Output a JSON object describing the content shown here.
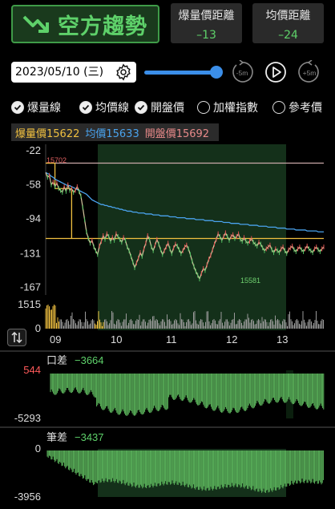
{
  "header": {
    "trend_title": "空方趨勢",
    "metric1": {
      "label": "爆量價距離",
      "value": "–13"
    },
    "metric2": {
      "label": "均價距離",
      "value": "–24"
    }
  },
  "controls": {
    "date": "2023/05/10 (三)",
    "back_label": "-5m",
    "forward_label": "+5m",
    "slider_fraction": 1.0
  },
  "toggles": [
    {
      "label": "爆量線",
      "checked": true
    },
    {
      "label": "均價線",
      "checked": true
    },
    {
      "label": "開盤價",
      "checked": true
    },
    {
      "label": "加權指數",
      "checked": false
    },
    {
      "label": "參考價",
      "checked": false
    }
  ],
  "legend": {
    "burst": {
      "label": "爆量價15622",
      "color": "#f0c040"
    },
    "avg": {
      "label": "均價15633",
      "color": "#4aa3ee"
    },
    "open": {
      "label": "開盤價15692",
      "color": "#e88a8a"
    }
  },
  "chart_data": [
    {
      "type": "line",
      "name": "price",
      "yticks": [
        "-22",
        "-58",
        "-94",
        "-131",
        "-167"
      ],
      "ylim": [
        -175,
        -15
      ],
      "x": [
        0,
        2,
        4,
        6,
        8,
        10,
        12,
        14,
        16,
        18,
        20,
        22,
        24,
        26,
        28,
        30,
        32,
        34,
        36,
        38,
        40,
        42,
        44,
        46,
        48,
        50,
        52,
        54,
        56,
        58,
        60,
        62,
        64,
        66,
        68,
        70,
        72,
        74,
        76,
        78,
        80,
        82,
        84,
        86,
        88,
        90,
        92,
        94,
        96,
        98,
        100,
        102,
        104,
        106,
        108,
        110,
        112,
        114,
        116,
        118,
        120,
        122,
        124,
        126,
        128,
        130,
        132,
        134,
        136,
        138,
        140,
        142,
        144,
        146,
        148,
        150,
        152,
        154,
        156,
        158,
        160,
        162,
        164,
        166,
        168,
        170,
        172,
        174,
        176,
        178,
        180,
        182,
        184,
        186,
        188,
        190,
        192,
        194,
        196,
        198,
        200,
        202,
        204,
        206,
        208,
        210,
        212,
        214,
        216,
        218,
        220,
        222,
        224,
        226,
        228,
        230,
        232,
        234,
        236,
        238,
        240,
        242,
        244,
        246,
        248,
        250,
        252,
        254,
        256,
        258,
        260,
        262,
        264,
        266,
        268,
        270,
        272,
        274,
        276,
        278,
        280,
        282,
        284,
        286,
        288,
        290,
        292,
        294,
        296,
        298,
        300
      ],
      "price": [
        -45,
        -50,
        -48,
        -58,
        -55,
        -60,
        -56,
        -62,
        -64,
        -66,
        -60,
        -65,
        -58,
        -64,
        -62,
        -66,
        -64,
        -60,
        -65,
        -70,
        -82,
        -95,
        -108,
        -115,
        -120,
        -117,
        -124,
        -128,
        -132,
        -123,
        -118,
        -112,
        -116,
        -110,
        -113,
        -118,
        -114,
        -117,
        -110,
        -113,
        -116,
        -119,
        -114,
        -117,
        -124,
        -128,
        -134,
        -140,
        -146,
        -141,
        -136,
        -130,
        -134,
        -126,
        -120,
        -112,
        -116,
        -124,
        -128,
        -122,
        -116,
        -121,
        -127,
        -132,
        -128,
        -124,
        -120,
        -126,
        -131,
        -125,
        -121,
        -123,
        -127,
        -131,
        -128,
        -124,
        -122,
        -126,
        -132,
        -139,
        -145,
        -150,
        -154,
        -158,
        -152,
        -147,
        -149,
        -143,
        -137,
        -133,
        -127,
        -121,
        -116,
        -110,
        -113,
        -117,
        -113,
        -109,
        -113,
        -117,
        -113,
        -111,
        -115,
        -113,
        -110,
        -116,
        -118,
        -114,
        -118,
        -120,
        -118,
        -115,
        -119,
        -121,
        -123,
        -119,
        -121,
        -125,
        -128,
        -126,
        -124,
        -122,
        -127,
        -130,
        -126,
        -128,
        -130,
        -126,
        -124,
        -128,
        -131,
        -127,
        -125,
        -123,
        -127,
        -129,
        -126,
        -124,
        -127,
        -129,
        -126,
        -123,
        -126,
        -128,
        -130,
        -126,
        -124,
        -127,
        -129,
        -126,
        -124
      ],
      "avg_line": [
        -45,
        -46,
        -47,
        -49,
        -50,
        -52,
        -53,
        -54,
        -55,
        -56,
        -57,
        -58,
        -59,
        -59,
        -60,
        -61,
        -62,
        -63,
        -64,
        -65,
        -66,
        -67,
        -68,
        -70,
        -72,
        -74,
        -75,
        -76,
        -77,
        -78,
        -79,
        -79,
        -80,
        -80,
        -81,
        -81,
        -82,
        -82,
        -83,
        -83,
        -84,
        -84,
        -85,
        -85,
        -86,
        -86,
        -86,
        -87,
        -87,
        -87,
        -88,
        -88,
        -88,
        -88,
        -89,
        -89,
        -89,
        -89,
        -90,
        -90,
        -90,
        -90,
        -91,
        -91,
        -91,
        -91,
        -91,
        -92,
        -92,
        -92,
        -92,
        -93,
        -93,
        -93,
        -93,
        -93,
        -94,
        -94,
        -94,
        -94,
        -94,
        -95,
        -95,
        -95,
        -95,
        -95,
        -96,
        -96,
        -96,
        -96,
        -96,
        -97,
        -97,
        -97,
        -97,
        -97,
        -98,
        -98,
        -98,
        -98,
        -99,
        -99,
        -99,
        -99,
        -99,
        -100,
        -100,
        -100,
        -100,
        -100,
        -101,
        -101,
        -101,
        -101,
        -101,
        -102,
        -102,
        -102,
        -102,
        -102,
        -103,
        -103,
        -103,
        -103,
        -103,
        -104,
        -104,
        -104,
        -104,
        -104,
        -105,
        -105,
        -105,
        -105,
        -105,
        -106,
        -106,
        -106,
        -106,
        -106,
        -106,
        -107,
        -107,
        -107,
        -107,
        -107,
        -107,
        -108,
        -108,
        -108,
        -108
      ],
      "open_line": -35,
      "burst_line": -115,
      "annotations": [
        {
          "text": "15702"
        },
        {
          "text": "15581"
        }
      ]
    },
    {
      "type": "bar",
      "name": "volume",
      "yticks": [
        "1515",
        "0"
      ],
      "xticks": [
        "09",
        "10",
        "11",
        "12",
        "13"
      ]
    },
    {
      "type": "area",
      "name": "口差",
      "title": "口差",
      "value": "−3664",
      "yticks": [
        "544",
        "-5293"
      ]
    },
    {
      "type": "area",
      "name": "筆差",
      "title": "筆差",
      "value": "−3437",
      "yticks": [
        "0",
        "-3956"
      ]
    }
  ]
}
